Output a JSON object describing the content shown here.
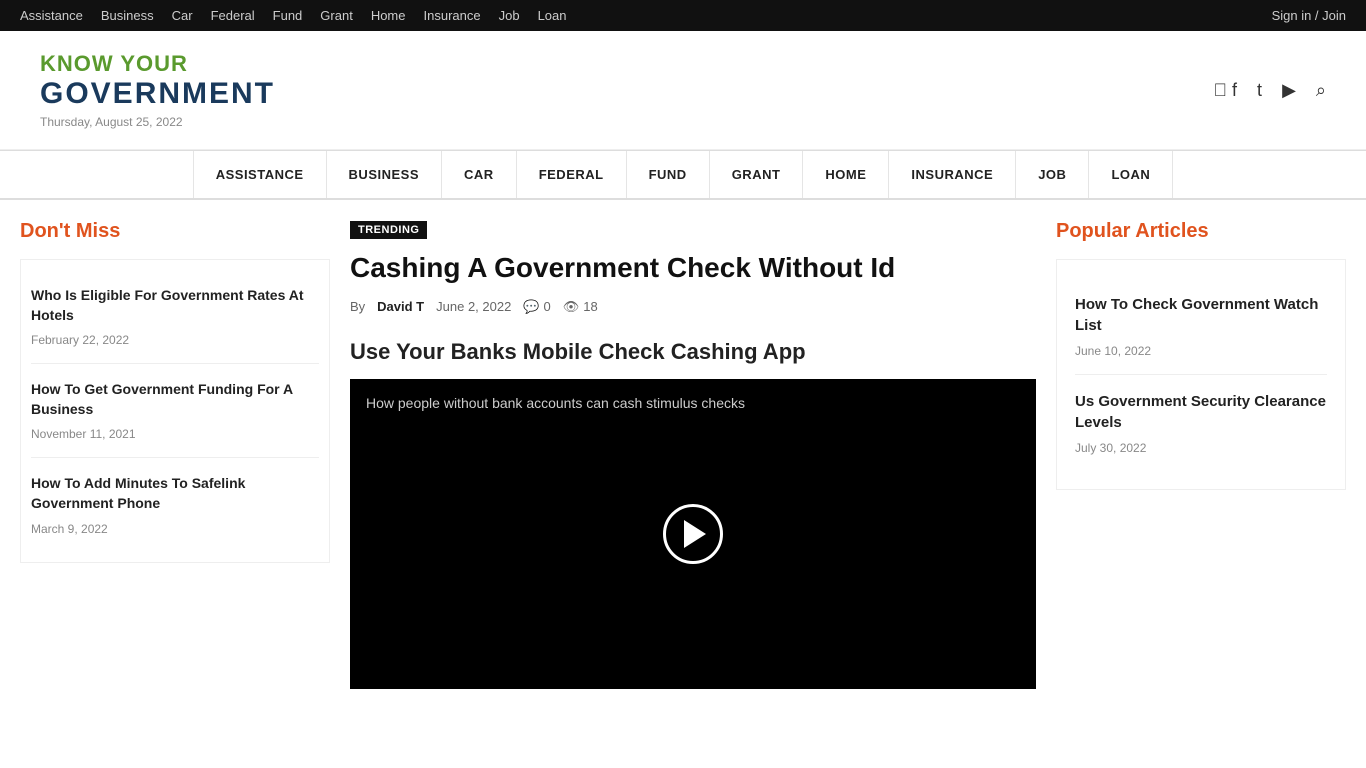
{
  "topbar": {
    "links": [
      "Assistance",
      "Business",
      "Car",
      "Federal",
      "Fund",
      "Grant",
      "Home",
      "Insurance",
      "Job",
      "Loan"
    ],
    "signin": "Sign in / Join"
  },
  "header": {
    "logo_know": "KNOW YOUR",
    "logo_gov": "GOVERNMENT",
    "date": "Thursday, August 25, 2022",
    "icons": [
      "facebook",
      "twitter",
      "youtube",
      "search"
    ]
  },
  "mainnav": {
    "items": [
      "ASSISTANCE",
      "BUSINESS",
      "CAR",
      "FEDERAL",
      "FUND",
      "GRANT",
      "HOME",
      "INSURANCE",
      "JOB",
      "LOAN"
    ]
  },
  "article": {
    "trending_label": "TRENDING",
    "title": "Cashing A Government Check Without Id",
    "by_label": "By",
    "author": "David T",
    "date": "June 2, 2022",
    "comments": "0",
    "views": "18",
    "video_section_title": "Use Your Banks Mobile Check Cashing App",
    "video_caption": "How people without bank accounts can cash stimulus checks"
  },
  "dont_miss": {
    "title": "Don't Miss",
    "articles": [
      {
        "title": "Who Is Eligible For Government Rates At Hotels",
        "date": "February 22, 2022"
      },
      {
        "title": "How To Get Government Funding For A Business",
        "date": "November 11, 2021"
      },
      {
        "title": "How To Add Minutes To Safelink Government Phone",
        "date": "March 9, 2022"
      }
    ]
  },
  "popular": {
    "title": "Popular Articles",
    "articles": [
      {
        "title": "How To Check Government Watch List",
        "date": "June 10, 2022"
      },
      {
        "title": "Us Government Security Clearance Levels",
        "date": "July 30, 2022"
      }
    ]
  }
}
